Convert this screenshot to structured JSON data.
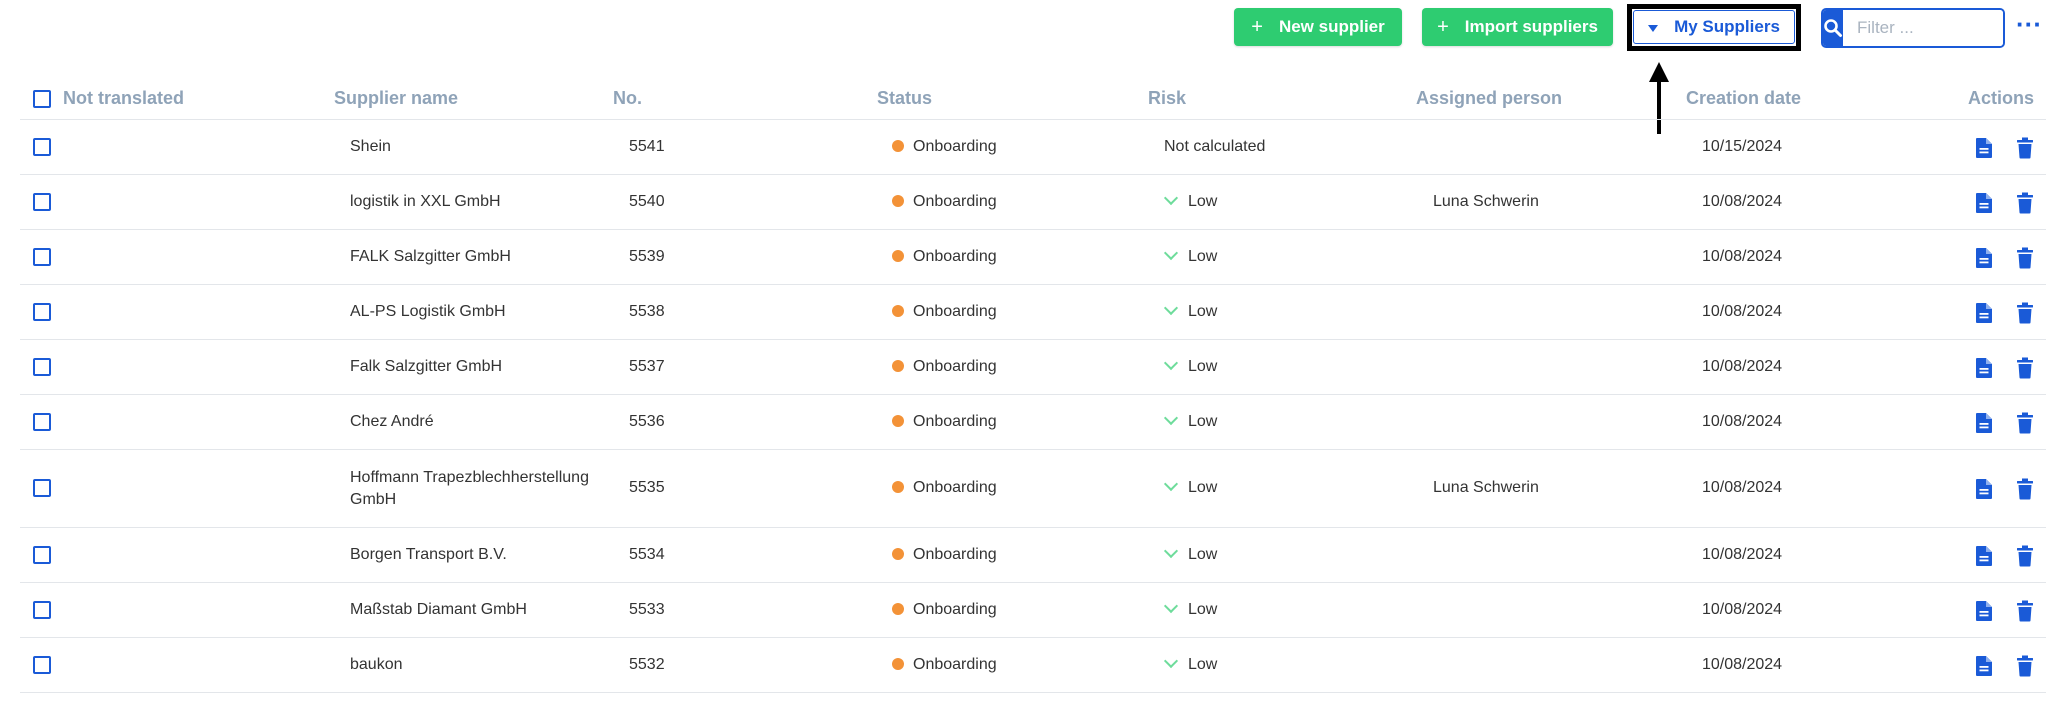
{
  "toolbar": {
    "new_supplier_label": "New supplier",
    "import_suppliers_label": "Import suppliers",
    "my_suppliers_label": "My Suppliers",
    "filter_placeholder": "Filter ...",
    "more_label": "···"
  },
  "colors": {
    "primary_blue": "#1a5ad7",
    "green_button": "#2ecc71",
    "status_orange": "#f39237",
    "risk_low_green": "#6edc9b",
    "header_text": "#8fa3b8"
  },
  "table": {
    "headers": {
      "select_all": "Not translated",
      "supplier_name": "Supplier name",
      "no": "No.",
      "status": "Status",
      "risk": "Risk",
      "assigned_person": "Assigned person",
      "creation_date": "Creation date",
      "actions": "Actions"
    },
    "rows": [
      {
        "name": "Shein",
        "no": "5541",
        "status": "Onboarding",
        "risk": "Not calculated",
        "person": "",
        "date": "10/15/2024"
      },
      {
        "name": "logistik in XXL GmbH",
        "no": "5540",
        "status": "Onboarding",
        "risk": "Low",
        "person": "Luna Schwerin",
        "date": "10/08/2024"
      },
      {
        "name": "FALK Salzgitter GmbH",
        "no": "5539",
        "status": "Onboarding",
        "risk": "Low",
        "person": "",
        "date": "10/08/2024"
      },
      {
        "name": "AL-PS Logistik GmbH",
        "no": "5538",
        "status": "Onboarding",
        "risk": "Low",
        "person": "",
        "date": "10/08/2024"
      },
      {
        "name": "Falk Salzgitter GmbH",
        "no": "5537",
        "status": "Onboarding",
        "risk": "Low",
        "person": "",
        "date": "10/08/2024"
      },
      {
        "name": "Chez André",
        "no": "5536",
        "status": "Onboarding",
        "risk": "Low",
        "person": "",
        "date": "10/08/2024"
      },
      {
        "name": "Hoffmann Trapezblechherstellung GmbH",
        "no": "5535",
        "status": "Onboarding",
        "risk": "Low",
        "person": "Luna Schwerin",
        "date": "10/08/2024"
      },
      {
        "name": "Borgen Transport B.V.",
        "no": "5534",
        "status": "Onboarding",
        "risk": "Low",
        "person": "",
        "date": "10/08/2024"
      },
      {
        "name": "Maßstab Diamant GmbH",
        "no": "5533",
        "status": "Onboarding",
        "risk": "Low",
        "person": "",
        "date": "10/08/2024"
      },
      {
        "name": "baukon",
        "no": "5532",
        "status": "Onboarding",
        "risk": "Low",
        "person": "",
        "date": "10/08/2024"
      }
    ]
  }
}
